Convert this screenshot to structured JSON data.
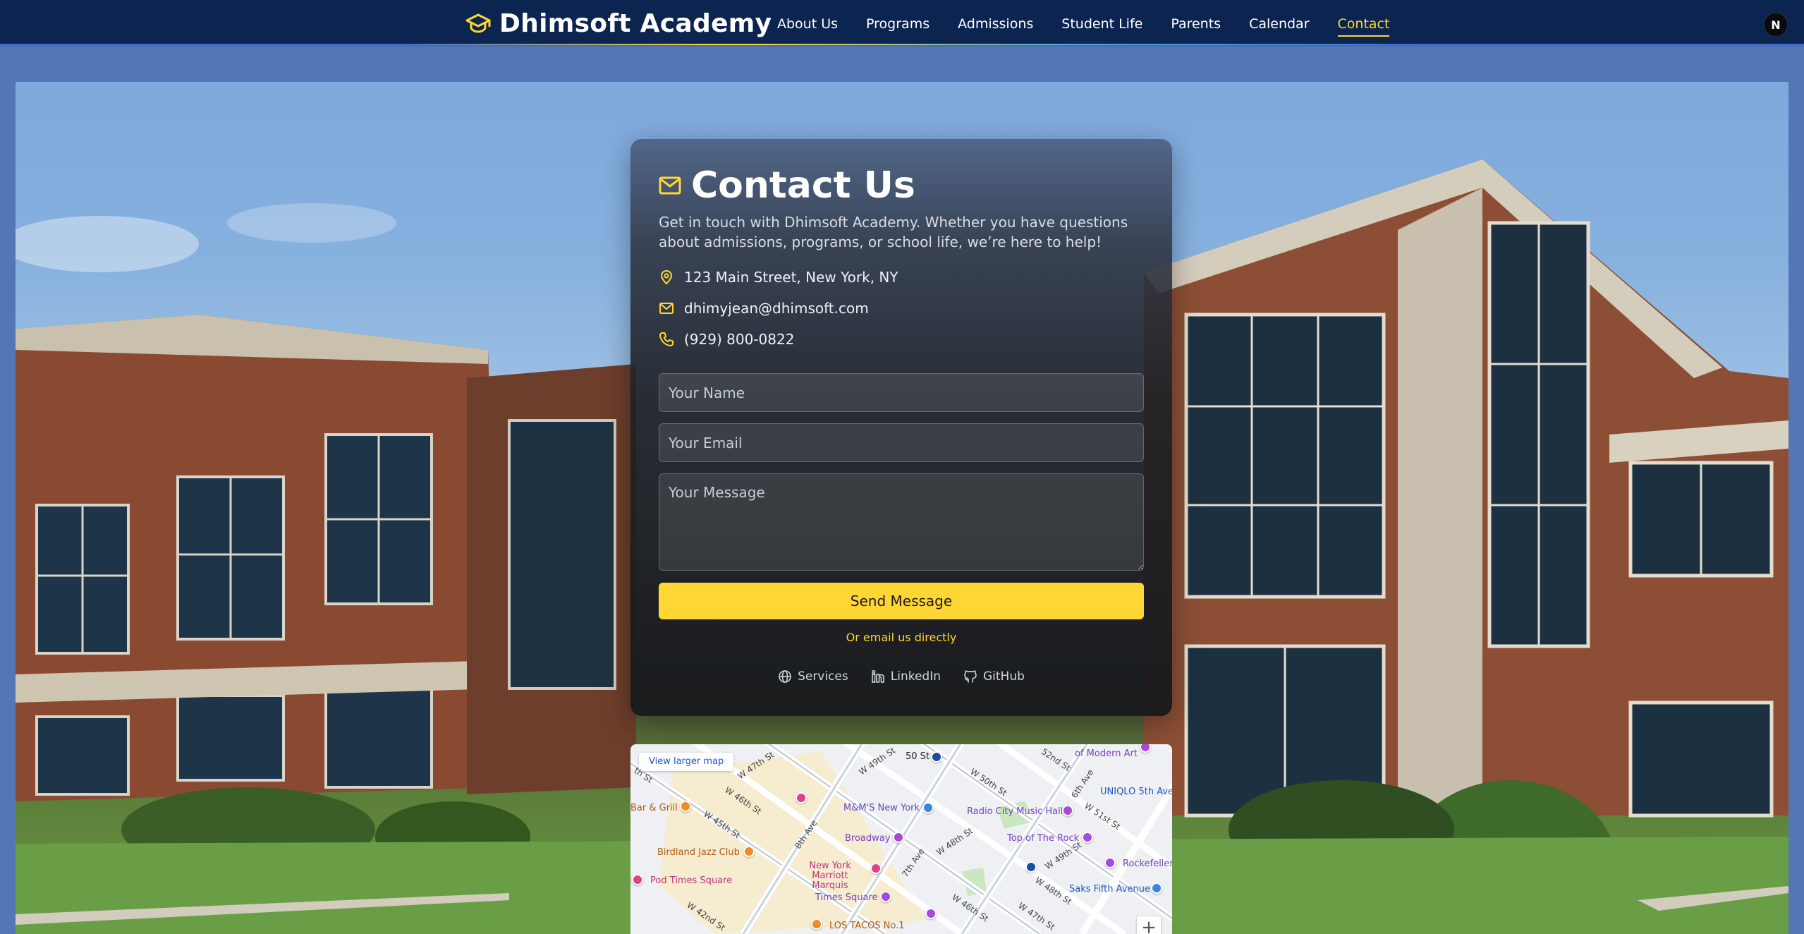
{
  "header": {
    "brand": "Dhimsoft Academy",
    "nav": [
      {
        "label": "About Us",
        "active": false
      },
      {
        "label": "Programs",
        "active": false
      },
      {
        "label": "Admissions",
        "active": false
      },
      {
        "label": "Student Life",
        "active": false
      },
      {
        "label": "Parents",
        "active": false
      },
      {
        "label": "Calendar",
        "active": false
      },
      {
        "label": "Contact",
        "active": true
      }
    ],
    "avatar_text": "N"
  },
  "contact": {
    "title": "Contact Us",
    "description": "Get in touch with Dhimsoft Academy. Whether you have questions about admissions, programs, or school life, we’re here to help!",
    "address": "123 Main Street, New York, NY",
    "email": "dhimyjean@dhimsoft.com",
    "phone": "(929) 800-0822",
    "form": {
      "name_placeholder": "Your Name",
      "email_placeholder": "Your Email",
      "message_placeholder": "Your Message",
      "name_value": "",
      "email_value": "",
      "message_value": "",
      "submit_label": "Send Message"
    },
    "alt_link": "Or email us directly",
    "socials": [
      {
        "label": "Services",
        "icon": "globe-icon"
      },
      {
        "label": "LinkedIn",
        "icon": "linkedin-icon"
      },
      {
        "label": "GitHub",
        "icon": "github-icon"
      }
    ]
  },
  "map": {
    "larger_map": "View larger map",
    "zoom_in": "+",
    "places": [
      "50 St",
      "M&M'S New York",
      "Radio City Music Hall",
      "of Modern Art",
      "UNIQLO 5th Ave",
      "Bar & Grill",
      "Birdland Jazz Club",
      "Broadway",
      "Top of The Rock",
      "Rockefeller",
      "New York Marriott Marquis",
      "Saks Fifth Avenue",
      "Pod Times Square",
      "Times Square",
      "LOS TACOS No.1"
    ],
    "streets": [
      "W 47th St",
      "W 49th St",
      "W 50th St",
      "52nd St",
      "6th Ave",
      "W 51st St",
      "W 46th St",
      "W 45th St",
      "8th Ave",
      "7th Ave",
      "W 48th St",
      "W 49th St",
      "th St",
      "W 46th St",
      "W 48th St",
      "W 47th St",
      "W 42nd St"
    ]
  },
  "colors": {
    "header_bg": "#0c2450",
    "accent": "#ffd633",
    "page_bg": "#5576b6"
  }
}
